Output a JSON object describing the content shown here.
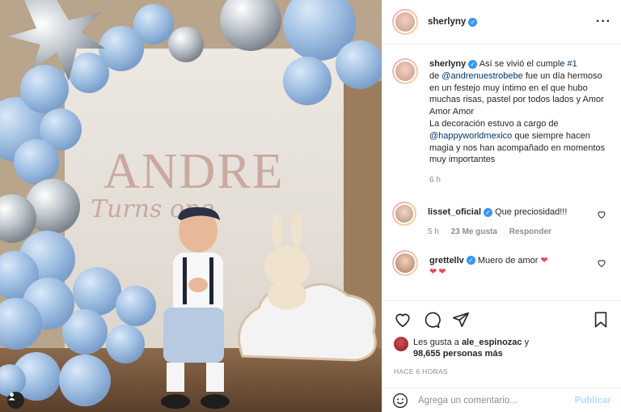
{
  "post": {
    "author": "sherlyny",
    "verified": true,
    "photo_text": {
      "name": "ANDRE",
      "subtitle": "Turns one"
    }
  },
  "caption": {
    "author": "sherlyny",
    "text_1": " Así se vivió el cumple ",
    "hashtag": "#1",
    "text_2": " de ",
    "mention_1": "@andrenuestrobebe",
    "text_3": " fue un día hermoso en un festejo muy íntimo en el que hubo muchas risas, pastel por todos lados y Amor Amor Amor",
    "text_4": "La decoración estuvo a cargo de ",
    "mention_2": "@happyworldmexico",
    "text_5": " que siempre hacen magia y nos han acompañado en momentos muy importantes",
    "time": "6 h"
  },
  "comments": [
    {
      "author": "lisset_oficial",
      "text": "Que preciosidad!!!",
      "time": "5 h",
      "likes": "23 Me gusta",
      "reply": "Responder"
    },
    {
      "author": "grettellv",
      "text": "Muero de amor",
      "emoji": "❤",
      "emoji_line": "❤❤"
    }
  ],
  "actions": {
    "liked_by_prefix": "Les gusta a ",
    "liked_by_user": "ale_espinozac",
    "liked_by_suffix": " y",
    "others": "98,655 personas más",
    "timestamp": "HACE 6 HORAS"
  },
  "composer": {
    "placeholder": "Agrega un comentario...",
    "publish": "Publicar"
  },
  "colors": {
    "verified": "#3897f0",
    "heart": "#ed4956",
    "link": "#00376b",
    "publish": "#b2dffc"
  }
}
